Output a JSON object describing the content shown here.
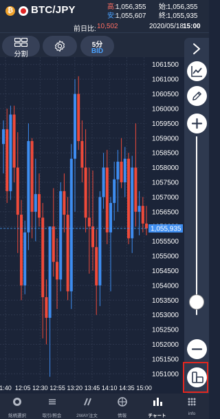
{
  "header": {
    "pair": "BTC/JPY",
    "high_label": "高:",
    "high_value": "1,056,355",
    "low_label": "安:",
    "low_value": "1,055,607",
    "open_label": "始:",
    "open_value": "1,056,355",
    "close_label": "終:",
    "close_value": "1,055,935",
    "change_label": "前日比:",
    "change_value": "10,502",
    "date": "2020/05/18",
    "time": "15:00"
  },
  "toolbar": {
    "split_label": "分割",
    "interval_label": "5分",
    "price_type": "BID"
  },
  "chart_data": {
    "type": "candlestick",
    "current_price": "1,055,935",
    "x_tick_labels": [
      "1:40",
      "12:05",
      "12:30",
      "12:55",
      "13:20",
      "13:45",
      "14:10",
      "14:35",
      "15:00"
    ],
    "y_tick_labels": [
      "1061500",
      "1061000",
      "1060500",
      "1060000",
      "1059500",
      "1059000",
      "1058500",
      "1058000",
      "1057500",
      "1057000",
      "1056500",
      "1056000",
      "1055500",
      "1055000",
      "1054500",
      "1054000",
      "1053500",
      "1053000",
      "1052500",
      "1052000",
      "1051500",
      "1051000"
    ],
    "ylim": [
      1050750,
      1061750
    ],
    "colors": {
      "up": "#3e8df0",
      "down": "#ef4a3a"
    },
    "candles": [
      {
        "o": 1058800,
        "h": 1059600,
        "l": 1057800,
        "c": 1059300
      },
      {
        "o": 1059300,
        "h": 1060000,
        "l": 1056800,
        "c": 1057200
      },
      {
        "o": 1057200,
        "h": 1060100,
        "l": 1056900,
        "c": 1059800
      },
      {
        "o": 1059800,
        "h": 1060100,
        "l": 1057500,
        "c": 1058000
      },
      {
        "o": 1058000,
        "h": 1059200,
        "l": 1055100,
        "c": 1056400
      },
      {
        "o": 1056400,
        "h": 1056900,
        "l": 1053500,
        "c": 1054000
      },
      {
        "o": 1054000,
        "h": 1056200,
        "l": 1053700,
        "c": 1055800
      },
      {
        "o": 1055800,
        "h": 1059500,
        "l": 1055200,
        "c": 1058900
      },
      {
        "o": 1058900,
        "h": 1059000,
        "l": 1055600,
        "c": 1056500
      },
      {
        "o": 1056500,
        "h": 1058300,
        "l": 1055500,
        "c": 1057100
      },
      {
        "o": 1057100,
        "h": 1057800,
        "l": 1056000,
        "c": 1056300
      },
      {
        "o": 1056300,
        "h": 1056800,
        "l": 1052200,
        "c": 1053600
      },
      {
        "o": 1053600,
        "h": 1054200,
        "l": 1052000,
        "c": 1052900
      },
      {
        "o": 1052900,
        "h": 1056000,
        "l": 1050900,
        "c": 1056000
      },
      {
        "o": 1056000,
        "h": 1057300,
        "l": 1054300,
        "c": 1054800
      },
      {
        "o": 1054800,
        "h": 1055600,
        "l": 1053200,
        "c": 1054200
      },
      {
        "o": 1054200,
        "h": 1057500,
        "l": 1053800,
        "c": 1057200
      },
      {
        "o": 1057200,
        "h": 1057800,
        "l": 1055800,
        "c": 1056400
      },
      {
        "o": 1056400,
        "h": 1057000,
        "l": 1053500,
        "c": 1053800
      },
      {
        "o": 1053800,
        "h": 1058800,
        "l": 1053200,
        "c": 1058300
      },
      {
        "o": 1058300,
        "h": 1061000,
        "l": 1056500,
        "c": 1060500
      },
      {
        "o": 1060500,
        "h": 1061100,
        "l": 1058600,
        "c": 1058900
      },
      {
        "o": 1058900,
        "h": 1059600,
        "l": 1057500,
        "c": 1058000
      },
      {
        "o": 1058000,
        "h": 1059300,
        "l": 1055800,
        "c": 1056300
      },
      {
        "o": 1056300,
        "h": 1058000,
        "l": 1054400,
        "c": 1056000
      },
      {
        "o": 1056000,
        "h": 1057900,
        "l": 1054500,
        "c": 1055300
      },
      {
        "o": 1055300,
        "h": 1055900,
        "l": 1053000,
        "c": 1054000
      },
      {
        "o": 1054000,
        "h": 1057200,
        "l": 1053300,
        "c": 1057000
      },
      {
        "o": 1057000,
        "h": 1058500,
        "l": 1056600,
        "c": 1058000
      },
      {
        "o": 1058000,
        "h": 1058600,
        "l": 1055400,
        "c": 1055800
      },
      {
        "o": 1055800,
        "h": 1057000,
        "l": 1053800,
        "c": 1056800
      },
      {
        "o": 1056800,
        "h": 1058200,
        "l": 1056200,
        "c": 1057600
      },
      {
        "o": 1057600,
        "h": 1058600,
        "l": 1056500,
        "c": 1058200
      },
      {
        "o": 1058200,
        "h": 1059000,
        "l": 1057300,
        "c": 1057500
      },
      {
        "o": 1057500,
        "h": 1058700,
        "l": 1057000,
        "c": 1058300
      },
      {
        "o": 1058300,
        "h": 1058500,
        "l": 1055400,
        "c": 1055600
      },
      {
        "o": 1055600,
        "h": 1058400,
        "l": 1055100,
        "c": 1058000
      },
      {
        "o": 1058000,
        "h": 1059500,
        "l": 1056000,
        "c": 1056500
      },
      {
        "o": 1056500,
        "h": 1057200,
        "l": 1055700,
        "c": 1056700
      },
      {
        "o": 1056700,
        "h": 1057000,
        "l": 1055800,
        "c": 1056100
      },
      {
        "o": 1056100,
        "h": 1056700,
        "l": 1055700,
        "c": 1055935
      }
    ]
  },
  "side_panel": {
    "icons": [
      "chevron-right-icon",
      "line-chart-icon",
      "pencil-icon",
      "zoom-in-icon",
      "zoom-out-icon",
      "rotate-screen-icon"
    ]
  },
  "bottom_nav": {
    "items": [
      {
        "label": "銘柄選択",
        "icon": "coin-select-icon"
      },
      {
        "label": "取引/照会",
        "icon": "trade-history-icon"
      },
      {
        "label": "2WAY注文",
        "icon": "two-way-order-icon"
      },
      {
        "label": "情報",
        "icon": "info-globe-icon"
      },
      {
        "label": "チャート",
        "icon": "chart-icon",
        "active": true
      },
      {
        "label": "info",
        "icon": "more-icon"
      }
    ]
  }
}
